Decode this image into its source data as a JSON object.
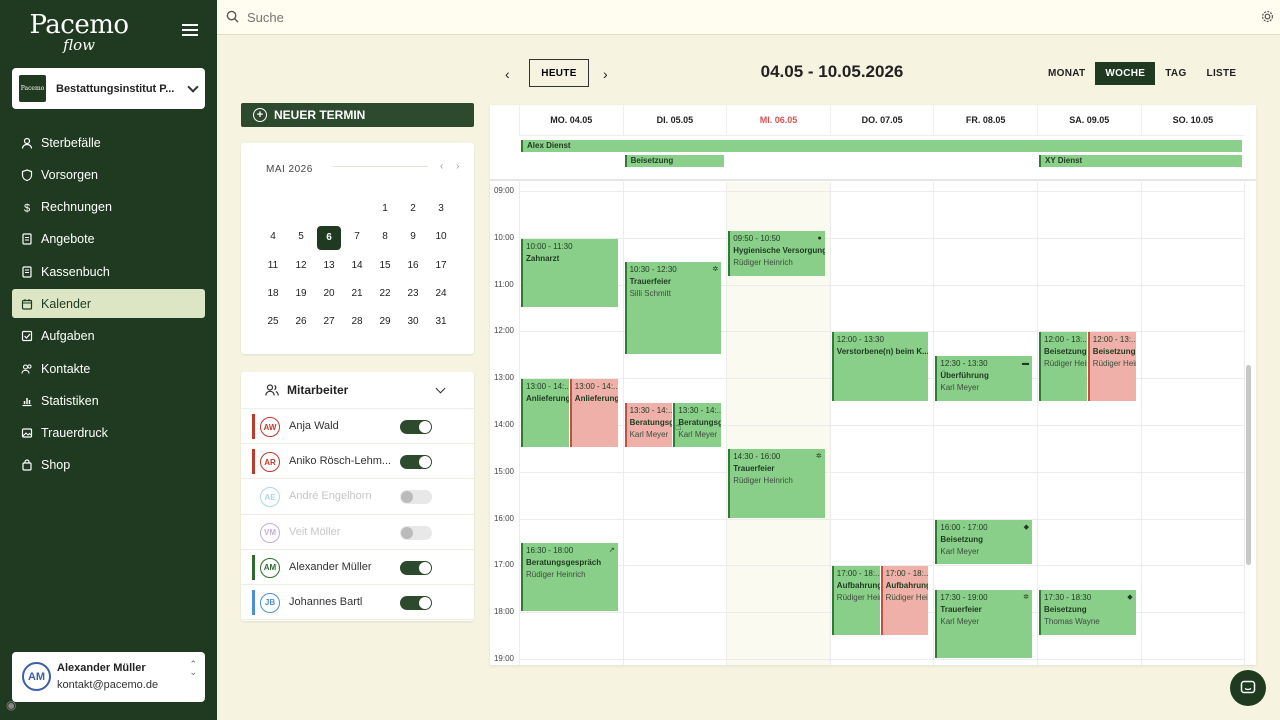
{
  "app": {
    "logo_main": "Pacemo",
    "logo_sub": "flow",
    "org_name": "Bestattungsinstitut P...",
    "org_logo_text": "Pacemo"
  },
  "search": {
    "placeholder": "Suche"
  },
  "nav": [
    {
      "label": "Sterbefälle",
      "icon": "person-icon"
    },
    {
      "label": "Vorsorgen",
      "icon": "shield-icon"
    },
    {
      "label": "Rechnungen",
      "icon": "dollar-icon"
    },
    {
      "label": "Angebote",
      "icon": "document-icon"
    },
    {
      "label": "Kassenbuch",
      "icon": "book-icon"
    },
    {
      "label": "Kalender",
      "icon": "calendar-icon",
      "active": true
    },
    {
      "label": "Aufgaben",
      "icon": "checkbox-icon"
    },
    {
      "label": "Kontakte",
      "icon": "contacts-icon"
    },
    {
      "label": "Statistiken",
      "icon": "chart-icon"
    },
    {
      "label": "Trauerdruck",
      "icon": "image-icon"
    },
    {
      "label": "Shop",
      "icon": "bag-icon"
    }
  ],
  "user": {
    "initials": "AM",
    "name": "Alexander Müller",
    "email": "kontakt@pacemo.de"
  },
  "new_button": "NEUER TERMIN",
  "mini_calendar": {
    "title": "MAI 2026",
    "selected": "6",
    "weeks": [
      [
        "",
        "",
        "",
        "",
        "1",
        "2",
        "3"
      ],
      [
        "4",
        "5",
        "6",
        "7",
        "8",
        "9",
        "10"
      ],
      [
        "11",
        "12",
        "13",
        "14",
        "15",
        "16",
        "17"
      ],
      [
        "18",
        "19",
        "20",
        "21",
        "22",
        "23",
        "24"
      ],
      [
        "25",
        "26",
        "27",
        "28",
        "29",
        "30",
        "31"
      ]
    ]
  },
  "staff": {
    "title": "Mitarbeiter",
    "members": [
      {
        "initials": "AW",
        "name": "Anja Wald",
        "color": "#c0392b",
        "enabled": true
      },
      {
        "initials": "AR",
        "name": "Aniko Rösch-Lehm...",
        "color": "#c0392b",
        "enabled": true
      },
      {
        "initials": "AE",
        "name": "André Engelhorn",
        "color": "#4aa9c9",
        "enabled": false
      },
      {
        "initials": "VM",
        "name": "Veit Möller",
        "color": "#7b4fa8",
        "enabled": false
      },
      {
        "initials": "AM",
        "name": "Alexander Müller",
        "color": "#2e6b2e",
        "enabled": true
      },
      {
        "initials": "JB",
        "name": "Johannes Bartl",
        "color": "#4a90d9",
        "enabled": true
      }
    ]
  },
  "calendar": {
    "today_label": "HEUTE",
    "range": "04.05 - 10.05.2026",
    "views": [
      "MONAT",
      "WOCHE",
      "TAG",
      "LISTE"
    ],
    "active_view": "WOCHE",
    "days": [
      "MO. 04.05",
      "DI. 05.05",
      "MI. 06.05",
      "DO. 07.05",
      "FR. 08.05",
      "SA. 09.05",
      "SO. 10.05"
    ],
    "today_index": 2,
    "hours": [
      "09:00",
      "10:00",
      "11:00",
      "12:00",
      "13:00",
      "14:00",
      "15:00",
      "16:00",
      "17:00",
      "18:00",
      "19:00"
    ],
    "allday": [
      {
        "title": "Alex Dienst",
        "day": 0,
        "span": 7,
        "row": 0
      },
      {
        "title": "Beisetzung",
        "day": 1,
        "span": 1,
        "row": 1
      },
      {
        "title": "XY Dienst",
        "day": 5,
        "span": 2,
        "row": 1
      }
    ],
    "events": [
      {
        "day": 0,
        "start": "10:00",
        "end": "11:30",
        "time": "10:00 - 11:30",
        "title": "Zahnarzt",
        "person": "",
        "sub": 0,
        "subs": 1,
        "color": "green"
      },
      {
        "day": 0,
        "start": "13:00",
        "end": "14:30",
        "time": "13:00 - 14:...",
        "title": "Anlieferung",
        "person": "",
        "sub": 0,
        "subs": 2,
        "color": "green"
      },
      {
        "day": 0,
        "start": "13:00",
        "end": "14:30",
        "time": "13:00 - 14:...",
        "title": "Anlieferung",
        "person": "",
        "sub": 1,
        "subs": 2,
        "color": "red"
      },
      {
        "day": 0,
        "start": "16:30",
        "end": "18:00",
        "time": "16:30 - 18:00",
        "title": "Beratungsgespräch",
        "person": "Rüdiger Heinrich",
        "sub": 0,
        "subs": 1,
        "color": "green",
        "icon": "link-icon"
      },
      {
        "day": 1,
        "start": "10:30",
        "end": "12:30",
        "time": "10:30 - 12:30",
        "title": "Trauerfeier",
        "person": "Silli Schmitt",
        "sub": 0,
        "subs": 1,
        "color": "green",
        "icon": "gear-icon"
      },
      {
        "day": 1,
        "start": "13:30",
        "end": "14:30",
        "time": "13:30 - 14:...",
        "title": "Beratungsgespräch",
        "person": "Karl Meyer",
        "sub": 0,
        "subs": 2,
        "color": "red"
      },
      {
        "day": 1,
        "start": "13:30",
        "end": "14:30",
        "time": "13:30 - 14:...",
        "title": "Beratungsgespräch",
        "person": "Karl Meyer",
        "sub": 1,
        "subs": 2,
        "color": "green"
      },
      {
        "day": 2,
        "start": "09:50",
        "end": "10:50",
        "time": "09:50 - 10:50",
        "title": "Hygienische Versorgung",
        "person": "Rüdiger Heinrich",
        "sub": 0,
        "subs": 1,
        "color": "green",
        "icon": "drop-icon"
      },
      {
        "day": 2,
        "start": "14:30",
        "end": "16:00",
        "time": "14:30 - 16:00",
        "title": "Trauerfeier",
        "person": "Rüdiger Heinrich",
        "sub": 0,
        "subs": 1,
        "color": "green",
        "icon": "gear-icon"
      },
      {
        "day": 3,
        "start": "12:00",
        "end": "13:30",
        "time": "12:00 - 13:30",
        "title": "Verstorbene(n) beim K...",
        "person": "",
        "sub": 0,
        "subs": 1,
        "color": "green"
      },
      {
        "day": 3,
        "start": "17:00",
        "end": "18:30",
        "time": "17:00 - 18:...",
        "title": "Aufbahrung",
        "person": "Rüdiger Heinrich",
        "sub": 0,
        "subs": 2,
        "color": "green"
      },
      {
        "day": 3,
        "start": "17:00",
        "end": "18:30",
        "time": "17:00 - 18:...",
        "title": "Aufbahrung",
        "person": "Rüdiger Heinrich",
        "sub": 1,
        "subs": 2,
        "color": "red"
      },
      {
        "day": 4,
        "start": "12:30",
        "end": "13:30",
        "time": "12:30 - 13:30",
        "title": "Überführung",
        "person": "Karl Meyer",
        "sub": 0,
        "subs": 1,
        "color": "green",
        "icon": "car-icon"
      },
      {
        "day": 4,
        "start": "16:00",
        "end": "17:00",
        "time": "16:00 - 17:00",
        "title": "Beisetzung",
        "person": "Karl Meyer",
        "sub": 0,
        "subs": 1,
        "color": "green",
        "icon": "coffin-icon"
      },
      {
        "day": 4,
        "start": "17:30",
        "end": "19:00",
        "time": "17:30 - 19:00",
        "title": "Trauerfeier",
        "person": "Karl Meyer",
        "sub": 0,
        "subs": 1,
        "color": "green",
        "icon": "gear-icon"
      },
      {
        "day": 5,
        "start": "12:00",
        "end": "13:30",
        "time": "12:00 - 13:...",
        "title": "Beisetzung",
        "person": "Rüdiger Heinrich",
        "sub": 0,
        "subs": 2,
        "color": "green"
      },
      {
        "day": 5,
        "start": "12:00",
        "end": "13:30",
        "time": "12:00 - 13:...",
        "title": "Beisetzung",
        "person": "Rüdiger Heinrich",
        "sub": 1,
        "subs": 2,
        "color": "red"
      },
      {
        "day": 5,
        "start": "17:30",
        "end": "18:30",
        "time": "17:30 - 18:30",
        "title": "Beisetzung",
        "person": "Thomas Wayne",
        "sub": 0,
        "subs": 1,
        "color": "green",
        "icon": "coffin-icon"
      }
    ]
  }
}
